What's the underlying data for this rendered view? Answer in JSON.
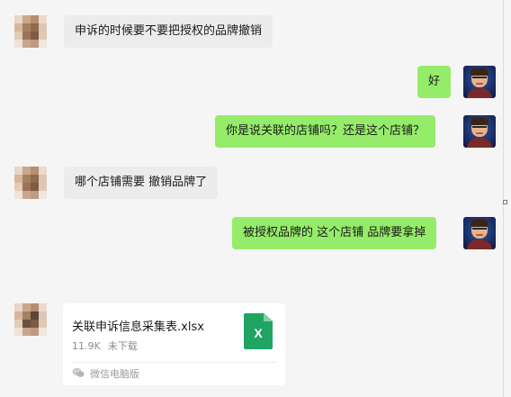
{
  "messages": [
    {
      "side": "in",
      "text": "申诉的时候要不要把授权的品牌撤销"
    },
    {
      "side": "out",
      "text": "好"
    },
    {
      "side": "out",
      "text": "你是说关联的店铺吗？还是这个店铺？"
    },
    {
      "side": "in",
      "text": "哪个店铺需要 撤销品牌了"
    },
    {
      "side": "out",
      "text": "被授权品牌的 这个店铺 品牌要拿掉"
    }
  ],
  "file": {
    "name": "关联申诉信息采集表.xlsx",
    "size": "11.9K",
    "status": "未下载",
    "source": "微信电脑版",
    "icon": "excel-icon",
    "icon_letter": "X"
  },
  "colors": {
    "background": "#f5f5f5",
    "incoming_bubble": "#ececec",
    "outgoing_bubble": "#95ec69",
    "excel_green": "#1fa463"
  }
}
